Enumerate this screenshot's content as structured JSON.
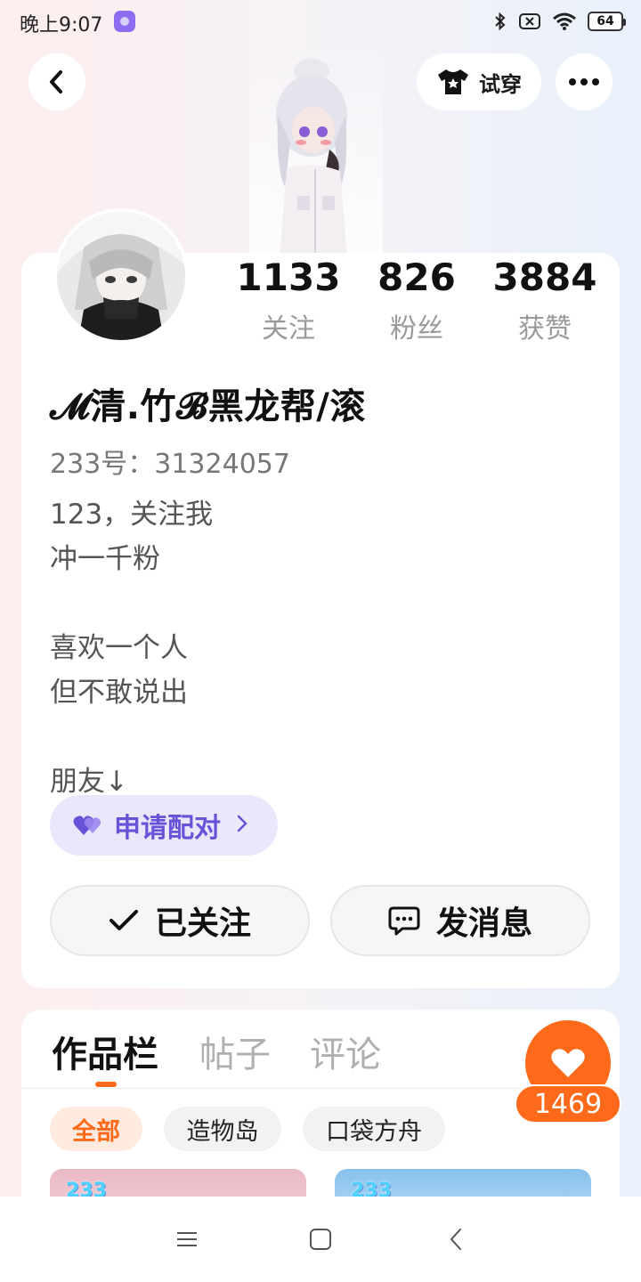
{
  "status_bar": {
    "time": "晚上9:07",
    "battery": "64",
    "icons": [
      "app-notification-icon",
      "bluetooth-icon",
      "sim-off-icon",
      "wifi-icon",
      "battery-icon"
    ]
  },
  "header": {
    "back_icon": "chevron-left-icon",
    "tryon_label": "试穿",
    "tryon_icon": "tshirt-icon",
    "more_icon": "more-dots-icon"
  },
  "profile": {
    "stats": [
      {
        "value": "1133",
        "label": "关注"
      },
      {
        "value": "826",
        "label": "粉丝"
      },
      {
        "value": "3884",
        "label": "获赞"
      }
    ],
    "username": "𝓜清.竹𝓑黑龙帮/滚",
    "user_id": "233号：31324057",
    "bio": "123，关注我\n冲一千粉\n\n喜欢一个人\n但不敢说出\n\n朋友↓",
    "pair_button": "申请配对",
    "follow_button": "已关注",
    "message_button": "发消息"
  },
  "works": {
    "tabs": [
      "作品栏",
      "帖子",
      "评论"
    ],
    "active_tab": "作品栏",
    "filters": [
      "全部",
      "造物岛",
      "口袋方舟"
    ],
    "active_filter": "全部",
    "thumbnail_badges": [
      "233",
      "233"
    ]
  },
  "like": {
    "count": "1469"
  },
  "colors": {
    "accent": "#ff6a1a",
    "pair_purple": "#6a52d8",
    "pair_bg": "#ebe7fb"
  }
}
